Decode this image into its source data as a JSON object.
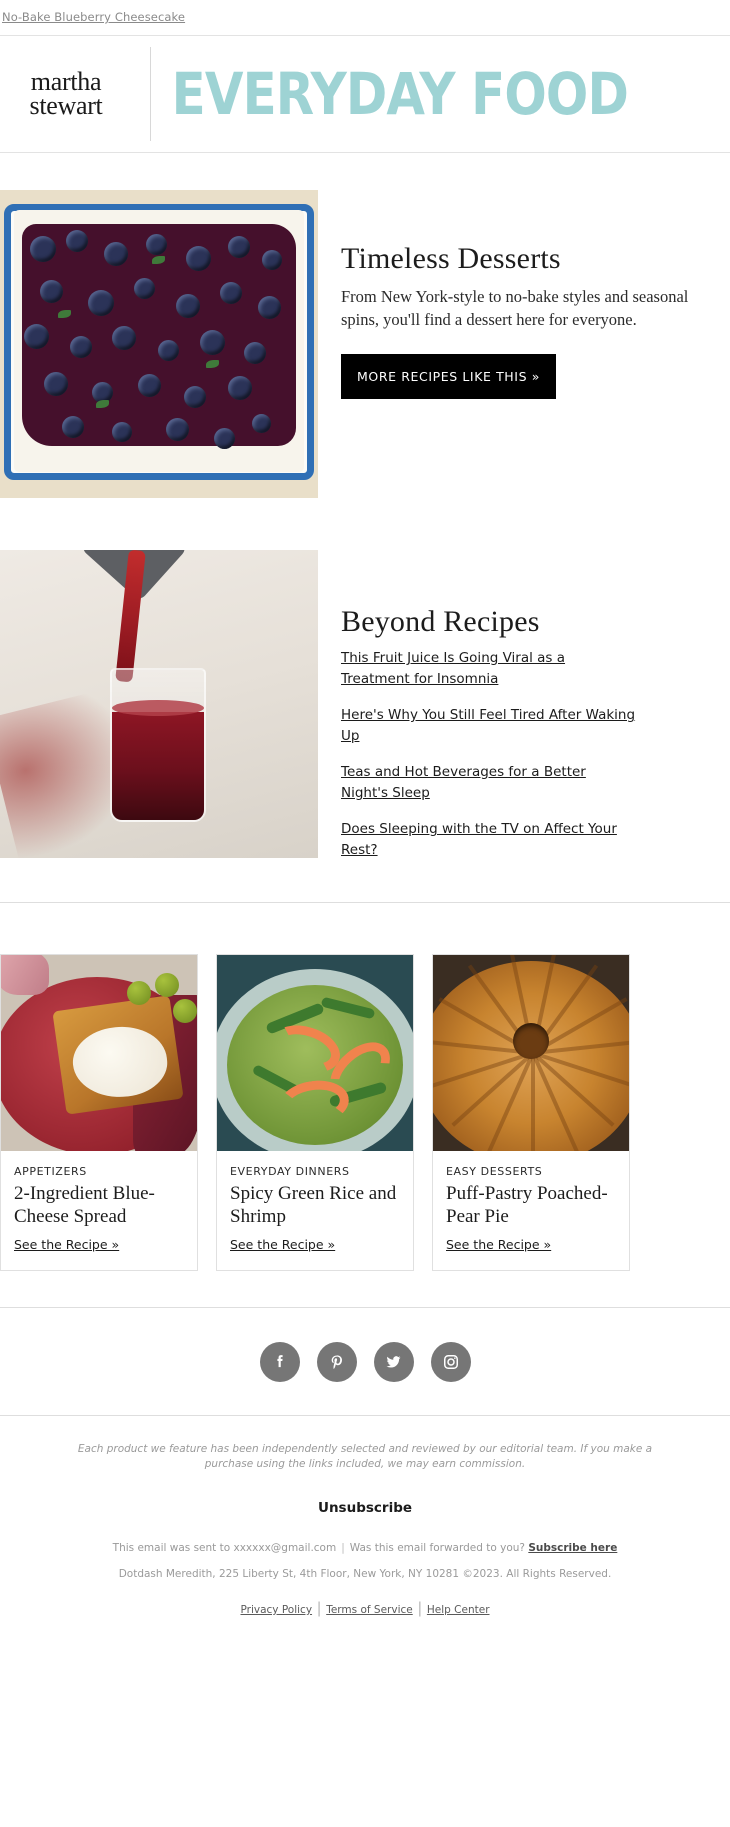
{
  "preheader": {
    "link_text": "No-Bake Blueberry Cheesecake"
  },
  "masthead": {
    "brand_line1": "martha",
    "brand_line2": "stewart",
    "publication": "EVERYDAY FOOD",
    "publication_color": "#9ed3d4"
  },
  "sections": [
    {
      "id": "timeless-desserts",
      "title": "Timeless Desserts",
      "body": "From New York-style to no-bake styles and seasonal spins, you'll find a dessert here for everyone.",
      "cta_label": "MORE RECIPES LIKE THIS »",
      "image_alt": "blueberry-cheesecake-image"
    },
    {
      "id": "beyond-recipes",
      "title": "Beyond Recipes",
      "links": [
        "This Fruit Juice Is Going Viral as a Treatment for Insomnia",
        "Here's Why You Still Feel Tired After Waking Up",
        "Teas and Hot Beverages for a Better Night's Sleep",
        "Does Sleeping with the TV on Affect Your Rest?"
      ],
      "image_alt": "tart-cherry-juice-pour-image"
    }
  ],
  "cards": [
    {
      "eyebrow": "APPETIZERS",
      "title": "2-Ingredient Blue-Cheese Spread",
      "link_label": "See the Recipe »",
      "image_alt": "blue-cheese-toast-image"
    },
    {
      "eyebrow": "EVERYDAY DINNERS",
      "title": "Spicy Green Rice and Shrimp",
      "link_label": "See the Recipe »",
      "image_alt": "green-rice-shrimp-image"
    },
    {
      "eyebrow": "EASY DESSERTS",
      "title": "Puff-Pastry Poached-Pear Pie",
      "link_label": "See the Recipe »",
      "image_alt": "puff-pastry-pear-pie-image"
    }
  ],
  "social": {
    "icon_background": "#767676",
    "items": [
      {
        "name": "facebook-icon"
      },
      {
        "name": "pinterest-icon"
      },
      {
        "name": "twitter-icon"
      },
      {
        "name": "instagram-icon"
      }
    ]
  },
  "footer": {
    "disclaimer": "Each product we feature has been independently selected and reviewed by our editorial team. If you make a purchase using the links included, we may earn commission.",
    "unsubscribe_label": "Unsubscribe",
    "sent_to_prefix": "This email was sent to ",
    "sent_to_address": "xxxxxx@gmail.com",
    "forwarded_question": "Was this email forwarded to you?",
    "subscribe_link": "Subscribe here",
    "address_line": "Dotdash Meredith, 225 Liberty St, 4th Floor, New York, NY 10281 ©2023. All Rights Reserved.",
    "legal_links": [
      "Privacy Policy",
      "Terms of Service",
      "Help Center"
    ],
    "separator": "|"
  }
}
